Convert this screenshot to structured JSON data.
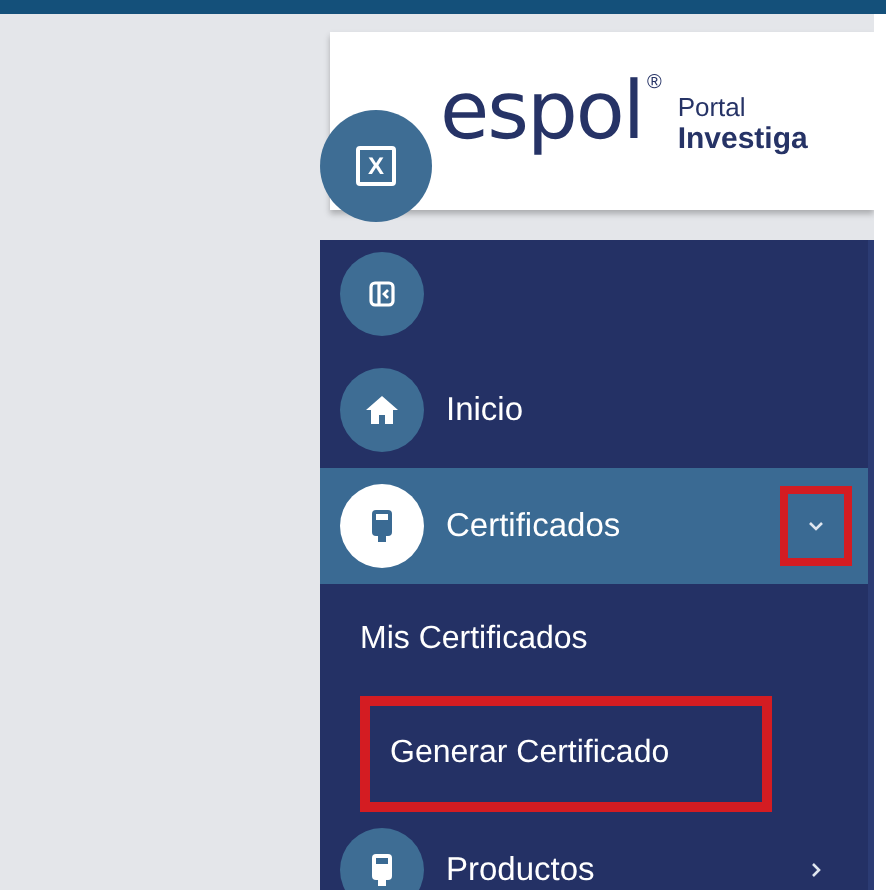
{
  "logo": {
    "wordmark": "espol",
    "registered": "®",
    "tagline": "Portal",
    "subtitle": "Investiga"
  },
  "close_button": {
    "label": "X"
  },
  "menu": [
    {
      "kind": "toggle"
    },
    {
      "kind": "link",
      "label": "Inicio",
      "selected": false
    },
    {
      "kind": "group",
      "label": "Certificados",
      "selected": true,
      "expanded": true,
      "highlighted": true,
      "children": [
        {
          "label": "Mis Certificados",
          "highlighted": false
        },
        {
          "label": "Generar Certificado",
          "highlighted": true
        }
      ]
    },
    {
      "kind": "group",
      "label": "Productos",
      "selected": false,
      "expanded": false,
      "highlighted": false
    }
  ]
}
